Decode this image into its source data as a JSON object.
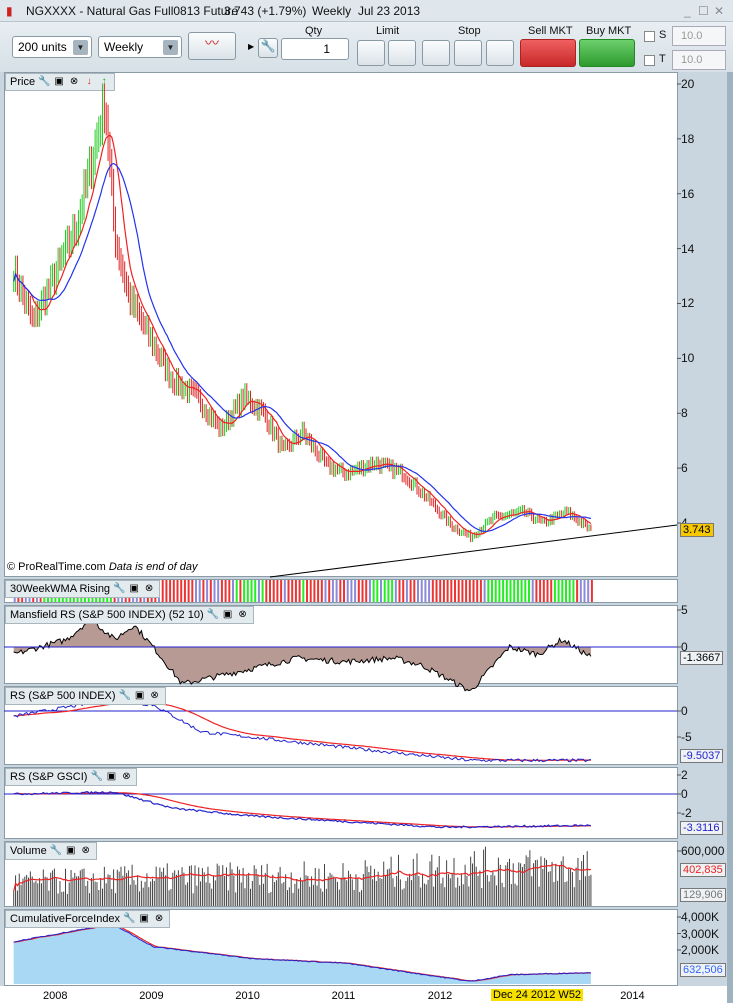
{
  "window": {
    "title": "NGXXXX - Natural Gas Full0813 Future",
    "price": "3.743 (+1.79%)",
    "timeframe": "Weekly",
    "date": "Jul 23 2013"
  },
  "toolbar": {
    "units": "200 units",
    "period": "Weekly",
    "qty_label": "Qty",
    "qty_value": "1",
    "limit_label": "Limit",
    "stop_label": "Stop",
    "sell_label": "Sell MKT",
    "buy_label": "Buy MKT",
    "s_label": "S",
    "t_label": "T",
    "s_value": "10.0",
    "t_value": "10.0"
  },
  "panels": {
    "price": {
      "label": "Price",
      "current": "3.743",
      "ticks": [
        "20",
        "18",
        "16",
        "14",
        "12",
        "10",
        "8",
        "6",
        "4"
      ],
      "copyright": "© ProRealTime.com",
      "note": "Data is end of day"
    },
    "wma": {
      "label": "30WeekWMA Rising"
    },
    "mansfield": {
      "label": "Mansfield RS (S&P 500 INDEX) (52 10)",
      "ticks": [
        "5",
        "0"
      ],
      "current": "-1.3667"
    },
    "rs_spx": {
      "label": "RS (S&P 500 INDEX)",
      "ticks": [
        "0",
        "-5"
      ],
      "current": "-9.5037"
    },
    "rs_gsci": {
      "label": "RS (S&P GSCI)",
      "ticks": [
        "2",
        "0",
        "-2"
      ],
      "current": "-3.3116"
    },
    "volume": {
      "label": "Volume",
      "ticks": [
        "600,000"
      ],
      "ma_value": "402,835",
      "current": "129,906"
    },
    "cfi": {
      "label": "CumulativeForceIndex",
      "ticks": [
        "4,000K",
        "3,000K",
        "2,000K"
      ],
      "current": "632,506"
    }
  },
  "xaxis": {
    "ticks": [
      "2008",
      "2009",
      "2010",
      "2011",
      "2012",
      "2014"
    ],
    "cursor": "Dec 24 2012 W52"
  },
  "colors": {
    "up": "#22cc22",
    "down": "#dd2222",
    "ma_fast": "#ee2222",
    "ma_slow": "#2233ee",
    "volume_ma": "#ee2222"
  },
  "chart_data": {
    "type": "line",
    "x_range": [
      2007.5,
      2014.3
    ],
    "price": {
      "ylim": [
        3.3,
        20.7
      ],
      "points": [
        [
          2007.55,
          13.2
        ],
        [
          2007.75,
          11.3
        ],
        [
          2007.95,
          12.8
        ],
        [
          2008.2,
          14.8
        ],
        [
          2008.35,
          17
        ],
        [
          2008.5,
          19.4
        ],
        [
          2008.6,
          14.5
        ],
        [
          2008.75,
          12.2
        ],
        [
          2009.0,
          10.5
        ],
        [
          2009.2,
          9.2
        ],
        [
          2009.45,
          8.6
        ],
        [
          2009.7,
          7.4
        ],
        [
          2009.95,
          8.6
        ],
        [
          2010.15,
          8
        ],
        [
          2010.35,
          6.6
        ],
        [
          2010.55,
          7.3
        ],
        [
          2010.8,
          6.1
        ],
        [
          2011.0,
          5.8
        ],
        [
          2011.3,
          6.2
        ],
        [
          2011.6,
          5.8
        ],
        [
          2011.85,
          4.9
        ],
        [
          2012.1,
          3.9
        ],
        [
          2012.3,
          3.5
        ],
        [
          2012.55,
          4.2
        ],
        [
          2012.85,
          4.4
        ],
        [
          2013.05,
          4.0
        ],
        [
          2013.3,
          4.4
        ],
        [
          2013.55,
          3.74
        ]
      ]
    },
    "mansfield": {
      "ylim": [
        -8,
        6
      ],
      "points": [
        [
          2007.55,
          -1
        ],
        [
          2008.1,
          1
        ],
        [
          2008.35,
          3.8
        ],
        [
          2008.6,
          1
        ],
        [
          2008.8,
          3
        ],
        [
          2009.0,
          0
        ],
        [
          2009.3,
          -5
        ],
        [
          2010.0,
          -3
        ],
        [
          2010.5,
          -1.5
        ],
        [
          2011.0,
          -2
        ],
        [
          2011.5,
          -1.5
        ],
        [
          2011.8,
          -2.5
        ],
        [
          2012.3,
          -6
        ],
        [
          2012.7,
          0
        ],
        [
          2013.0,
          -1
        ],
        [
          2013.25,
          1
        ],
        [
          2013.55,
          -1.37
        ]
      ]
    },
    "rs_spx": {
      "ylim": [
        -10.5,
        4.5
      ],
      "points": [
        [
          2007.55,
          -1
        ],
        [
          2008.5,
          2
        ],
        [
          2009.0,
          1.2
        ],
        [
          2009.5,
          -4
        ],
        [
          2010.5,
          -6
        ],
        [
          2011.5,
          -8
        ],
        [
          2012.3,
          -9.5
        ],
        [
          2013.55,
          -9.5
        ]
      ]
    },
    "rs_gsci": {
      "ylim": [
        -4,
        2.7
      ],
      "points": [
        [
          2007.55,
          0
        ],
        [
          2008.6,
          0.2
        ],
        [
          2009.2,
          -1.5
        ],
        [
          2010.0,
          -2.3
        ],
        [
          2011.0,
          -2.9
        ],
        [
          2012.0,
          -3.5
        ],
        [
          2013.55,
          -3.31
        ]
      ]
    },
    "volume": {
      "ylim": [
        0,
        700000
      ],
      "points": [
        [
          2007.55,
          250000
        ],
        [
          2009.0,
          300000
        ],
        [
          2011.0,
          320000
        ],
        [
          2012.3,
          420000
        ],
        [
          2013.55,
          400000
        ]
      ]
    },
    "cfi": {
      "ylim": [
        0,
        4600
      ],
      "points": [
        [
          2007.55,
          2500
        ],
        [
          2008.4,
          3400
        ],
        [
          2008.6,
          3500
        ],
        [
          2009.0,
          2200
        ],
        [
          2010.0,
          1500
        ],
        [
          2011.0,
          1200
        ],
        [
          2012.3,
          100
        ],
        [
          2012.7,
          500
        ],
        [
          2013.55,
          632
        ]
      ]
    }
  }
}
